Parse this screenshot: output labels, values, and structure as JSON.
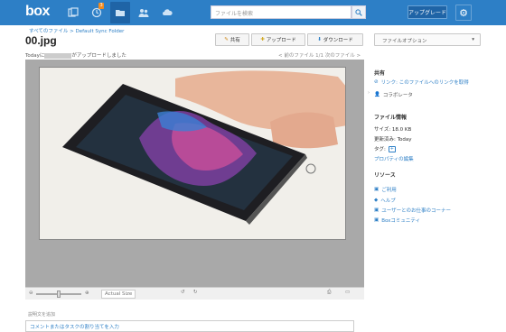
{
  "app": {
    "logo": "box",
    "nav_badge": "3"
  },
  "search": {
    "placeholder": "ファイルを検索"
  },
  "header": {
    "upgrade": "アップグレード"
  },
  "file": {
    "breadcrumb": "すべてのファイル > Default Sync Folder",
    "name": "00.jpg",
    "meta_prefix": "Todayに",
    "meta_suffix": "がアップロードしました",
    "actions": [
      "共有",
      "アップロード",
      "ダウンロード"
    ],
    "options": "ファイルオプション",
    "pager": "< 前のファイル  1/1  次のファイル >"
  },
  "preview": {
    "zoom_label": "Actual Size"
  },
  "comment": {
    "label": "説明文を追加",
    "placeholder": "コメントまたはタスクの割り当てを入力"
  },
  "sidebar": {
    "share": {
      "title": "共有",
      "link": "リンク: このファイルへのリンクを取得",
      "collab": "コラボレータ"
    },
    "info": {
      "title": "ファイル情報",
      "size": "サイズ: 18.0 KB",
      "modified": "更新済み: Today",
      "tags": "タグ:",
      "props": "プロパティの編集"
    },
    "resources": {
      "title": "リソース",
      "items": [
        "ご利用",
        "ヘルプ",
        "ユーザーとのお仕事のコーナー",
        "Boxコミュニティ"
      ]
    }
  }
}
